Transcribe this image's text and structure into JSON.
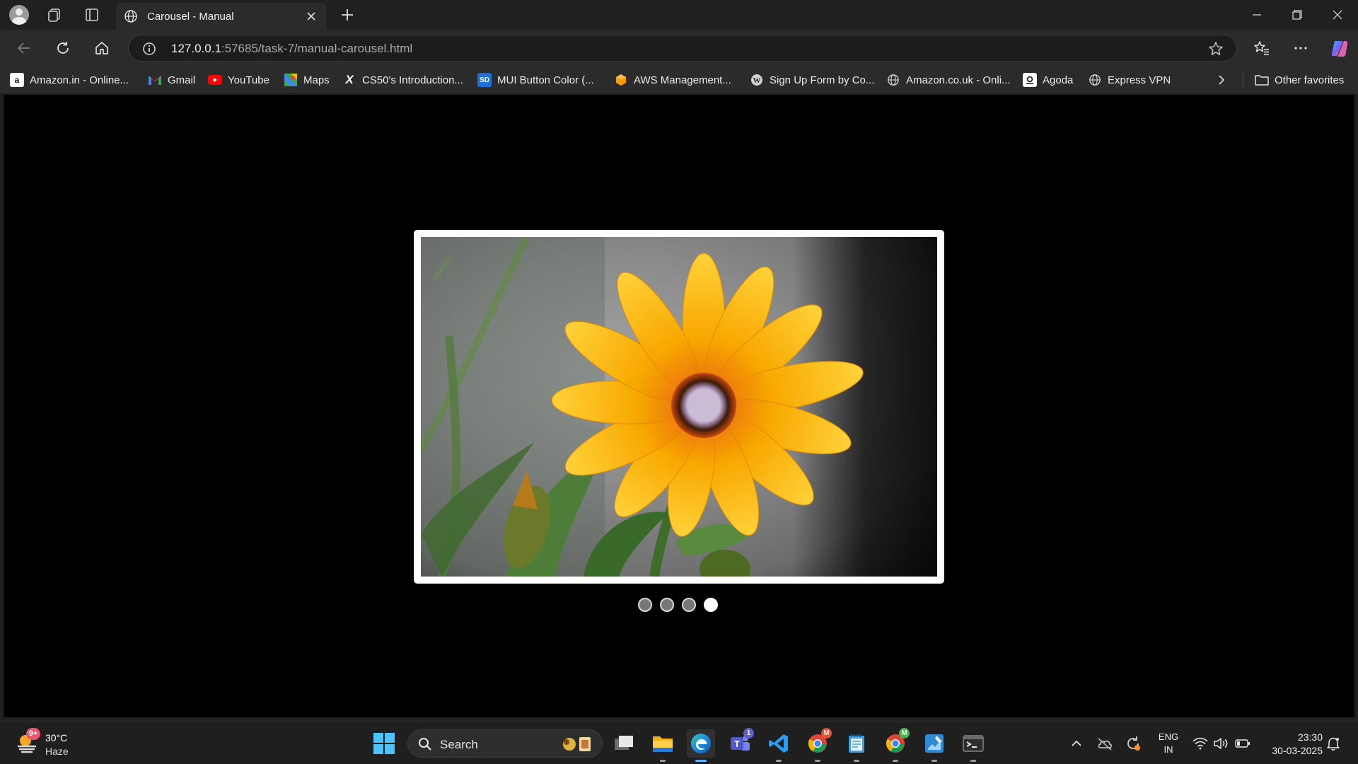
{
  "browser": {
    "tab_title": "Carousel - Manual",
    "url_host": "127.0.0.1",
    "url_rest": ":57685/task-7/manual-carousel.html"
  },
  "favorites": [
    {
      "label": "Amazon.in - Online...",
      "icon": "amazon-icon",
      "color": "#ffffff"
    },
    {
      "label": "Gmail",
      "icon": "gmail-icon",
      "color": "#ea4335"
    },
    {
      "label": "YouTube",
      "icon": "youtube-icon",
      "color": "#ff0000"
    },
    {
      "label": "Maps",
      "icon": "maps-icon",
      "color": "#34a853"
    },
    {
      "label": "CS50's Introduction...",
      "icon": "edx-icon",
      "color": "#ffffff"
    },
    {
      "label": "MUI Button Color (...",
      "icon": "sd-icon",
      "color": "#1e6fd9"
    },
    {
      "label": "AWS Management...",
      "icon": "aws-icon",
      "color": "#ff9900"
    },
    {
      "label": "Sign Up Form by Co...",
      "icon": "wordpress-icon",
      "color": "#cccccc"
    },
    {
      "label": "Amazon.co.uk - Onli...",
      "icon": "globe-icon",
      "color": "#cccccc"
    },
    {
      "label": "Agoda",
      "icon": "agoda-icon",
      "color": "#ffffff"
    },
    {
      "label": "Express VPN",
      "icon": "globe-icon",
      "color": "#cccccc"
    }
  ],
  "other_favorites": "Other favorites",
  "carousel": {
    "slide_count": 4,
    "active_index": 3,
    "current_image": "orange-daisy-flower"
  },
  "taskbar": {
    "weather_badge": "9+",
    "temperature": "30°C",
    "condition": "Haze",
    "search_label": "Search",
    "teams_badge": "1",
    "chrome_badge_1": "M",
    "chrome_badge_2": "M",
    "lang_line1": "ENG",
    "lang_line2": "IN",
    "time": "23:30",
    "date": "30-03-2025"
  },
  "colors": {
    "page_background": "#000000",
    "frame": "#ffffff",
    "active_dot": "#ffffff",
    "inactive_dot": "#777777"
  }
}
